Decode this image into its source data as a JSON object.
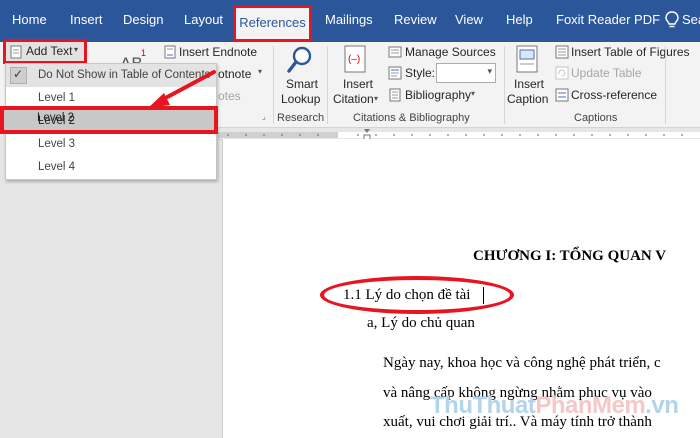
{
  "ribbon_tabs": [
    "Home",
    "Insert",
    "Design",
    "Layout",
    "References",
    "Mailings",
    "Review",
    "View",
    "Help",
    "Foxit Reader PDF"
  ],
  "active_tab": "References",
  "tell_me": "Sea",
  "ribbon": {
    "add_text": "Add Text",
    "insert_endnote": "Insert Endnote",
    "next_footnote_partial": "otnote",
    "show_notes_partial": "otes",
    "smart_lookup_1": "Smart",
    "smart_lookup_2": "Lookup",
    "research_group": "Research",
    "insert_citation_1": "Insert",
    "insert_citation_2": "Citation",
    "manage_sources": "Manage Sources",
    "style_label": "Style:",
    "bibliography": "Bibliography",
    "citations_group": "Citations & Bibliography",
    "insert_caption_1": "Insert",
    "insert_caption_2": "Caption",
    "insert_table_of_figures": "Insert Table of Figures",
    "update_table": "Update Table",
    "cross_reference": "Cross-reference",
    "captions_group": "Captions"
  },
  "dropdown": {
    "items": [
      "Do Not Show in Table of Contents",
      "Level 1",
      "Level 2",
      "Level 3",
      "Level 4"
    ],
    "checked_item": "Do Not Show in Table of Contents",
    "highlighted_item": "Level 2"
  },
  "document": {
    "chapter_title": "CHƯƠNG I: TỔNG QUAN V",
    "heading_1_1": "1.1 Lý do chọn đề tài",
    "subheading_a": "a, Lý do chủ quan",
    "para_line_1": "Ngày nay, khoa học và công nghệ phát triển, c",
    "para_line_2": "và nâng cấp không ngừng nhằm phục vụ vào",
    "para_line_3": "xuất, vui chơi giải trí.. Và máy tính trở thành"
  },
  "watermark": {
    "part_a": "ThuThuat",
    "part_b": "PhanMem",
    "part_c": ".vn"
  },
  "colors": {
    "ribbon_blue": "#2b579a",
    "annotation_red": "#e8141f"
  }
}
